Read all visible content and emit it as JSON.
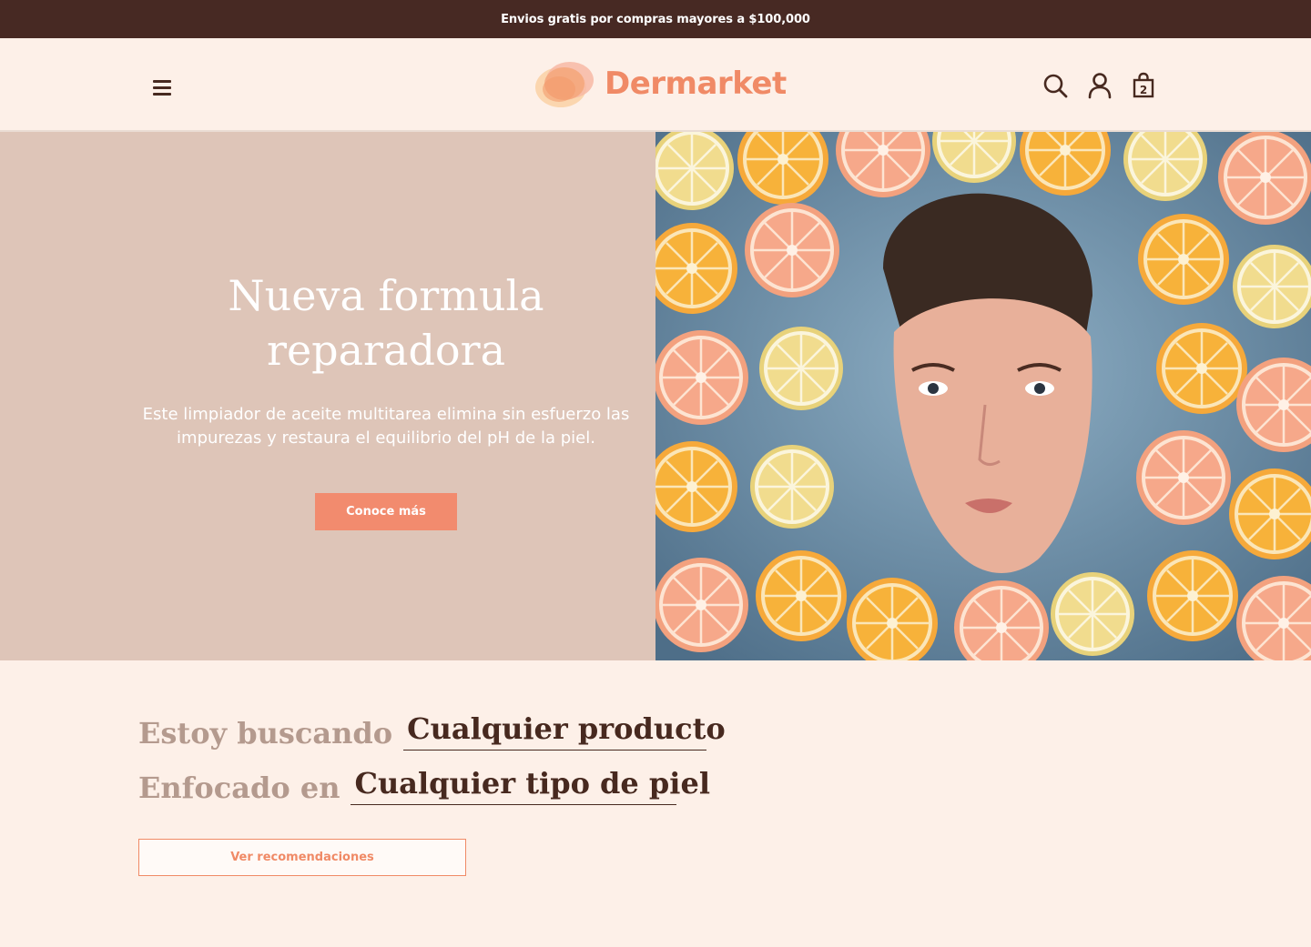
{
  "announcement": "Envios gratis por compras mayores a $100,000",
  "brand": {
    "name": "Dermarket",
    "accent": "#f08a66",
    "dark": "#47291f"
  },
  "header": {
    "menu_icon": "hamburger-icon",
    "search_icon": "search-icon",
    "account_icon": "user-icon",
    "cart_icon": "shopping-bag-icon",
    "cart_count": "2"
  },
  "hero": {
    "title": "Nueva formula reparadora",
    "description": "Este limpiador de aceite multitarea elimina sin esfuerzo las impurezas y restaura el equilibrio del pH de la piel.",
    "cta": "Conoce más",
    "image_alt": "woman-face-in-water-with-citrus-slices"
  },
  "finder": {
    "row1_label": "Estoy buscando",
    "row1_value": "Cualquier producto",
    "row2_label": "Enfocado en",
    "row2_value": "Cualquier tipo de piel",
    "button": "Ver recomendaciones"
  }
}
